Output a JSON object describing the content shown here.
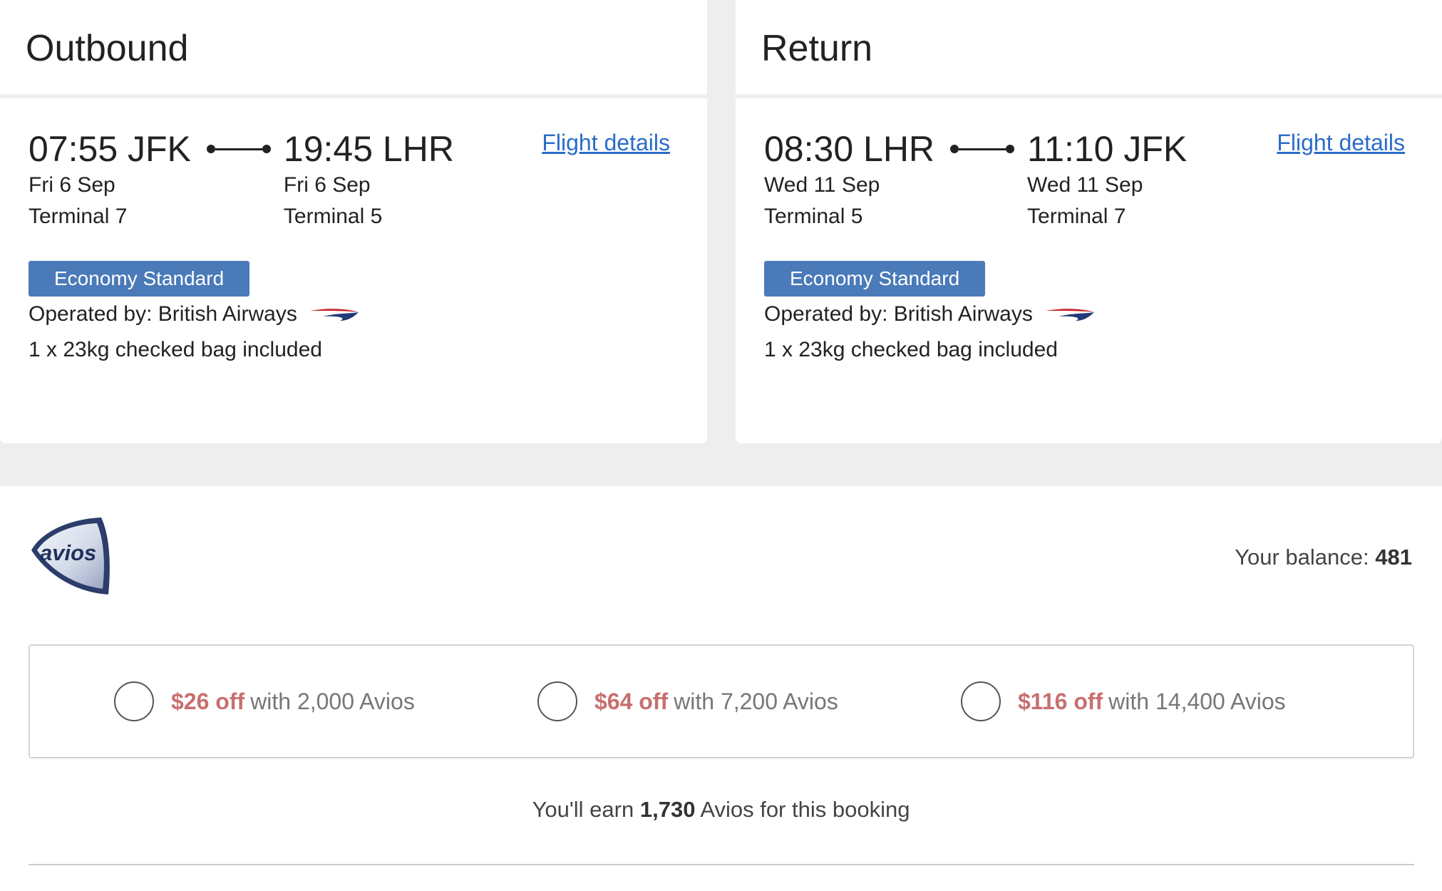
{
  "outbound": {
    "title": "Outbound",
    "depart": {
      "time_airport": "07:55 JFK",
      "date": "Fri 6 Sep",
      "terminal": "Terminal 7"
    },
    "arrive": {
      "time_airport": "19:45 LHR",
      "date": "Fri 6 Sep",
      "terminal": "Terminal 5"
    },
    "details_link": "Flight details",
    "cabin": "Economy Standard",
    "operated_by": "Operated by: British Airways",
    "baggage": "1 x 23kg checked bag included"
  },
  "return": {
    "title": "Return",
    "depart": {
      "time_airport": "08:30 LHR",
      "date": "Wed 11 Sep",
      "terminal": "Terminal 5"
    },
    "arrive": {
      "time_airport": "11:10 JFK",
      "date": "Wed 11 Sep",
      "terminal": "Terminal 7"
    },
    "details_link": "Flight details",
    "cabin": "Economy Standard",
    "operated_by": "Operated by: British Airways",
    "baggage": "1 x 23kg checked bag included"
  },
  "avios": {
    "logo_text": "avios",
    "balance_label": "Your balance:",
    "balance_value": "481",
    "options": [
      {
        "amount": "$26 off",
        "with": "with 2,000 Avios"
      },
      {
        "amount": "$64 off",
        "with": "with 7,200 Avios"
      },
      {
        "amount": "$116 off",
        "with": "with 14,400 Avios"
      }
    ],
    "earn_prefix": "You'll earn",
    "earn_value": "1,730",
    "earn_suffix": "Avios for this booking"
  },
  "colors": {
    "link": "#2b6cc9",
    "badge": "#4a7ab8",
    "discount": "#c76f6f",
    "page_bg": "#eeeeee"
  },
  "icons": {
    "connector": "route-connector-icon",
    "airline": "british-airways-speedmarque-icon",
    "avios": "avios-logo"
  }
}
